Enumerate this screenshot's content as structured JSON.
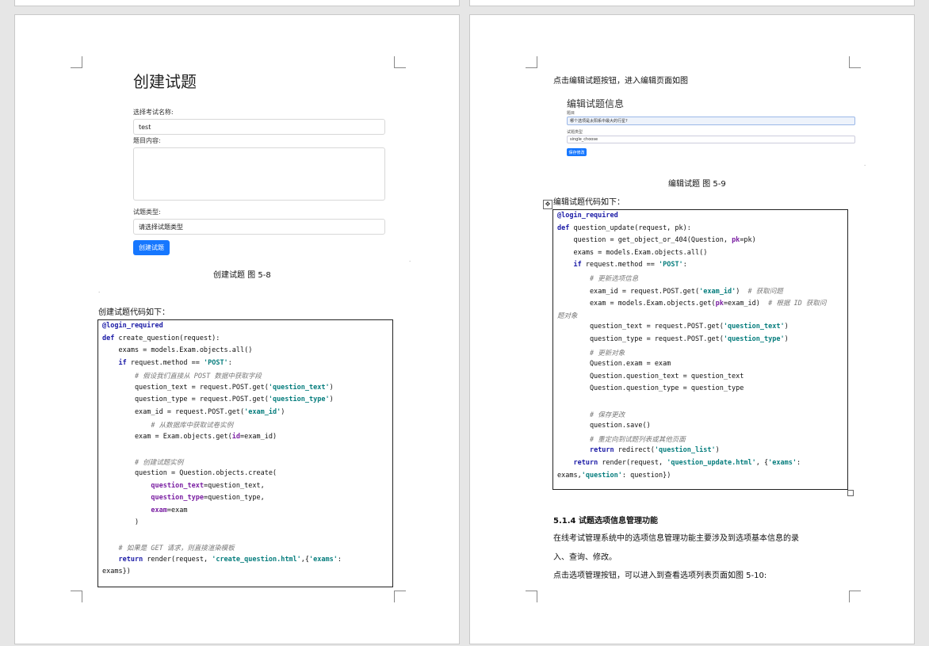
{
  "left_page": {
    "form": {
      "title": "创建试题",
      "exam_label": "选择考试名称:",
      "exam_value": "test",
      "content_label": "题目内容:",
      "type_label": "试题类型:",
      "type_placeholder": "请选择试题类型",
      "submit_label": "创建试题"
    },
    "caption": "创建试题  图 5-8",
    "intro": "创建试题代码如下：",
    "code": [
      [
        [
          "dec",
          "@login_required"
        ]
      ],
      [
        [
          "kw",
          "def"
        ],
        [
          "",
          "create_question(request):"
        ]
      ],
      [
        [
          "",
          "    exams = models.Exam.objects.all()"
        ]
      ],
      [
        [
          "",
          "    "
        ],
        [
          "kw",
          "if"
        ],
        [
          "",
          "request.method == "
        ],
        [
          "str",
          "'POST'"
        ],
        [
          "",
          ":"
        ]
      ],
      [
        [
          "",
          "        "
        ],
        [
          "cmt",
          "# 假设我们直接从 POST 数据中获取字段"
        ]
      ],
      [
        [
          "",
          "        question_text = request.POST.get("
        ],
        [
          "str",
          "'question_text'"
        ],
        [
          "",
          ")"
        ]
      ],
      [
        [
          "",
          "        question_type = request.POST.get("
        ],
        [
          "str",
          "'question_type'"
        ],
        [
          "",
          ")"
        ]
      ],
      [
        [
          "",
          "        exam_id = request.POST.get("
        ],
        [
          "str",
          "'exam_id'"
        ],
        [
          "",
          ")"
        ]
      ],
      [
        [
          "",
          "            "
        ],
        [
          "cmt",
          "# 从数据库中获取试卷实例"
        ]
      ],
      [
        [
          "",
          "        exam = Exam.objects.get("
        ],
        [
          "param",
          "id"
        ],
        [
          "",
          "=exam_id)"
        ]
      ],
      [
        [
          "",
          ""
        ]
      ],
      [
        [
          "",
          "        "
        ],
        [
          "cmt",
          "# 创建试题实例"
        ]
      ],
      [
        [
          "",
          "        question = Question.objects.create("
        ]
      ],
      [
        [
          "",
          "            "
        ],
        [
          "param",
          "question_text"
        ],
        [
          "",
          "=question_text,"
        ]
      ],
      [
        [
          "",
          "            "
        ],
        [
          "param",
          "question_type"
        ],
        [
          "",
          "=question_type,"
        ]
      ],
      [
        [
          "",
          "            "
        ],
        [
          "param",
          "exam"
        ],
        [
          "",
          "=exam"
        ]
      ],
      [
        [
          "",
          "        )"
        ]
      ],
      [
        [
          "",
          ""
        ]
      ],
      [
        [
          "",
          "    "
        ],
        [
          "cmt",
          "# 如果是 GET 请求，则直接渲染模板"
        ]
      ],
      [
        [
          "",
          "    "
        ],
        [
          "kw",
          "return"
        ],
        [
          "",
          "render(request, "
        ],
        [
          "str",
          "'create_question.html'"
        ],
        [
          "",
          ",{"
        ],
        [
          "str",
          "'exams'"
        ],
        [
          "",
          ":"
        ]
      ],
      [
        [
          "",
          "exams})"
        ]
      ]
    ]
  },
  "right_page": {
    "intro": "点击编辑试题按钮，进入编辑页面如图",
    "mini_form": {
      "title": "编辑试题信息",
      "content_label": "题目",
      "content_value": "哪个选项是太阳系中最大的行星?",
      "type_label": "试题类型",
      "type_value": "single_choose",
      "save_label": "保存修改"
    },
    "caption": "编辑试题  图 5-9",
    "code_intro": "编辑试题代码如下：",
    "code": [
      [
        [
          "dec",
          "@login_required"
        ]
      ],
      [
        [
          "kw",
          "def"
        ],
        [
          "",
          "question_update(request, pk):"
        ]
      ],
      [
        [
          "",
          "    question = get_object_or_404(Question, "
        ],
        [
          "param",
          "pk"
        ],
        [
          "",
          "=pk)"
        ]
      ],
      [
        [
          "",
          "    exams = models.Exam.objects.all()"
        ]
      ],
      [
        [
          "",
          "    "
        ],
        [
          "kw",
          "if"
        ],
        [
          "",
          "request.method == "
        ],
        [
          "str",
          "'POST'"
        ],
        [
          "",
          ":"
        ]
      ],
      [
        [
          "",
          "        "
        ],
        [
          "cmt",
          "# 更新选项信息"
        ]
      ],
      [
        [
          "",
          "        exam_id = request.POST.get("
        ],
        [
          "str",
          "'exam_id'"
        ],
        [
          "",
          ")  "
        ],
        [
          "cmt",
          "# 获取问题"
        ]
      ],
      [
        [
          "",
          "        exam = models.Exam.objects.get("
        ],
        [
          "param",
          "pk"
        ],
        [
          "",
          "=exam_id)  "
        ],
        [
          "cmt",
          "# 根据 ID 获取问"
        ]
      ],
      [
        [
          "cmt",
          "题对象"
        ]
      ],
      [
        [
          "",
          "        question_text = request.POST.get("
        ],
        [
          "str",
          "'question_text'"
        ],
        [
          "",
          ")"
        ]
      ],
      [
        [
          "",
          "        question_type = request.POST.get("
        ],
        [
          "str",
          "'question_type'"
        ],
        [
          "",
          ")"
        ]
      ],
      [
        [
          "",
          "        "
        ],
        [
          "cmt",
          "# 更新对象"
        ]
      ],
      [
        [
          "",
          "        Question.exam = exam"
        ]
      ],
      [
        [
          "",
          "        Question.question_text = question_text"
        ]
      ],
      [
        [
          "",
          "        Question.question_type = question_type"
        ]
      ],
      [
        [
          "",
          ""
        ]
      ],
      [
        [
          "",
          "        "
        ],
        [
          "cmt",
          "# 保存更改"
        ]
      ],
      [
        [
          "",
          "        question.save()"
        ]
      ],
      [
        [
          "",
          "        "
        ],
        [
          "cmt",
          "# 重定向到试题列表或其他页面"
        ]
      ],
      [
        [
          "",
          "        "
        ],
        [
          "kw",
          "return"
        ],
        [
          "",
          "redirect("
        ],
        [
          "str",
          "'question_list'"
        ],
        [
          "",
          ")"
        ]
      ],
      [
        [
          "",
          "    "
        ],
        [
          "kw",
          "return"
        ],
        [
          "",
          "render(request, "
        ],
        [
          "str",
          "'question_update.html'"
        ],
        [
          "",
          ", {"
        ],
        [
          "str",
          "'exams'"
        ],
        [
          "",
          ":"
        ]
      ],
      [
        [
          "",
          "exams,"
        ],
        [
          "str",
          "'question'"
        ],
        [
          "",
          ": question})"
        ]
      ]
    ],
    "section_heading": "5.1.4  试题选项信息管理功能",
    "section_p1a": "在线考试管理系统中的选项信息管理功能主要涉及到选项基本信息的录",
    "section_p1b": "入、查询、修改。",
    "section_p2": "点击选项管理按钮，可以进入到查看选项列表页面如图 5-10:"
  }
}
